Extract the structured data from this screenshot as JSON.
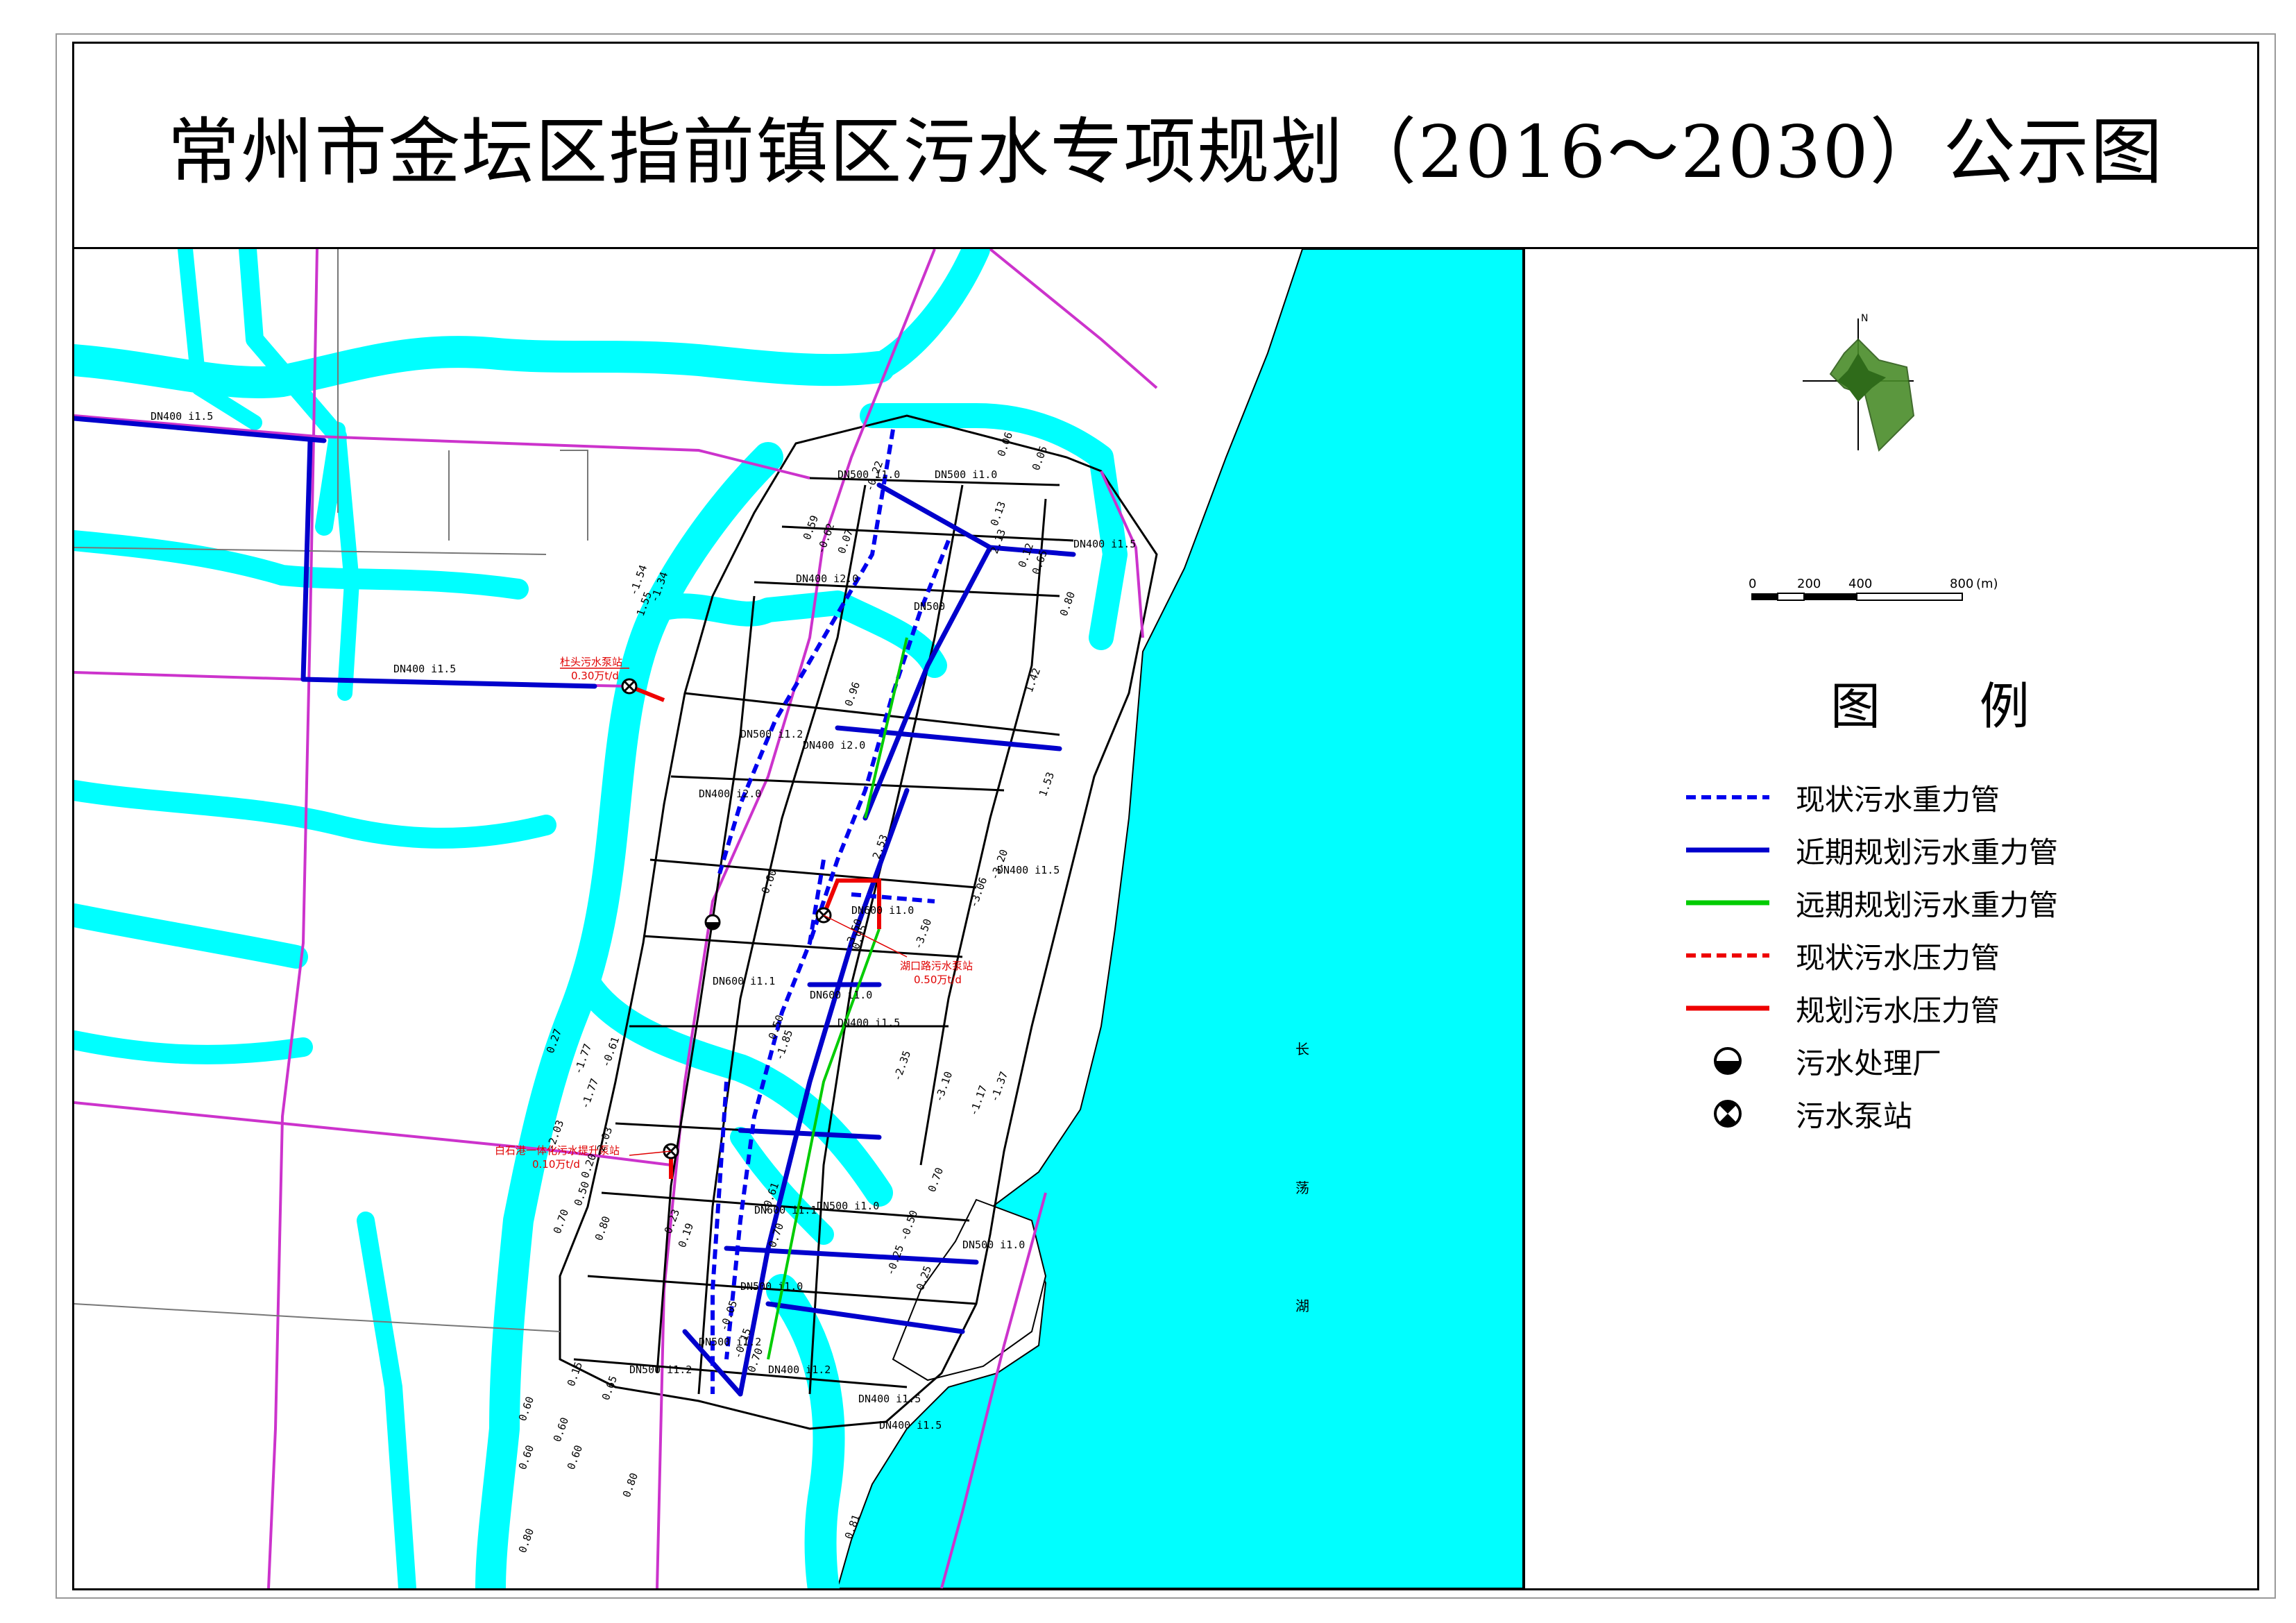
{
  "title": "常州市金坛区指前镇区污水专项规划（2016～2030）公示图",
  "colors": {
    "water": "#00ffff",
    "road_outline": "#000000",
    "road_pink": "#cc33cc",
    "pipe_existing_gravity": "#0000ee",
    "pipe_near_gravity": "#0000cc",
    "pipe_far_gravity": "#00cc00",
    "pipe_pressure": "#ee0000",
    "compass_fill": "#4a8c2a"
  },
  "legend": {
    "title": "图 例",
    "items": [
      {
        "label": "现状污水重力管",
        "symbol": "blue-dashed-line"
      },
      {
        "label": "近期规划污水重力管",
        "symbol": "blue-solid-line"
      },
      {
        "label": "远期规划污水重力管",
        "symbol": "green-solid-line"
      },
      {
        "label": "现状污水压力管",
        "symbol": "red-dashed-line"
      },
      {
        "label": "规划污水压力管",
        "symbol": "red-solid-line"
      },
      {
        "label": "污水处理厂",
        "symbol": "half-filled-circle"
      },
      {
        "label": "污水泵站",
        "symbol": "crossed-circle"
      }
    ]
  },
  "compass": {
    "label": "N"
  },
  "scale_bar": {
    "ticks": [
      "0",
      "200",
      "400",
      "800"
    ],
    "unit": "(m)"
  },
  "map_labels": {
    "lake": [
      "长",
      "荡",
      "湖"
    ],
    "stations": [
      {
        "name": "杜头污水泵站",
        "capacity": "0.30万t/d"
      },
      {
        "name": "湖口路污水泵站",
        "capacity": "0.50万t/d"
      },
      {
        "name": "白石港一体化污水提升泵站",
        "capacity": "0.10万t/d"
      }
    ],
    "pipes": [
      "DN400 i1.5",
      "DN400 i1.5",
      "DN400 i1.5",
      "DN400 i1.5",
      "DN400 i2.0",
      "DN400 i2.0",
      "DN500 i1.2",
      "DN500 i1.0",
      "DN600 i1.0",
      "DN600 i1.0",
      "DN500 i1.0",
      "DN600 i1.1",
      "DN400 i1.5",
      "DN500 i1.0",
      "DN500 i1.2",
      "DN400 i1.2",
      "DN500 i1.2",
      "DN400 i1.5",
      "DN500 i1.0",
      "DN500 i1.0",
      "DN400 i1.5",
      "DN600 i1.1",
      "DN400 i2.0",
      "DN500"
    ],
    "elevations": [
      "0.27",
      "-1.77",
      "-0.61",
      "-1.77",
      "-2.03",
      "-2.03",
      "0.20",
      "0.50",
      "0.70",
      "0.80",
      "0.15",
      "0.65",
      "0.60",
      "0.60",
      "0.60",
      "0.60",
      "0.80",
      "0.80",
      "0.81",
      "0.95",
      "1.53",
      "-1.54",
      "-1.34",
      "1.55",
      "2.13",
      "2.53",
      "-3.20",
      "-3.06",
      "-3.50",
      "-3.50",
      "-2.35",
      "-3.10",
      "-1.17",
      "-1.37",
      "0.70",
      "-0.50",
      "-0.25",
      "-0.25",
      "-0.61",
      "0.70",
      "-0.05",
      "0.70",
      "0.23",
      "0.19",
      "0.06",
      "0.05",
      "0.13",
      "0.12",
      "0.65",
      "0.80",
      "0.59",
      "-0.62",
      "0.07",
      "-0.22",
      "0.50",
      "-1.85",
      "1.42",
      "0.96",
      "0.60",
      "-0.15"
    ]
  }
}
